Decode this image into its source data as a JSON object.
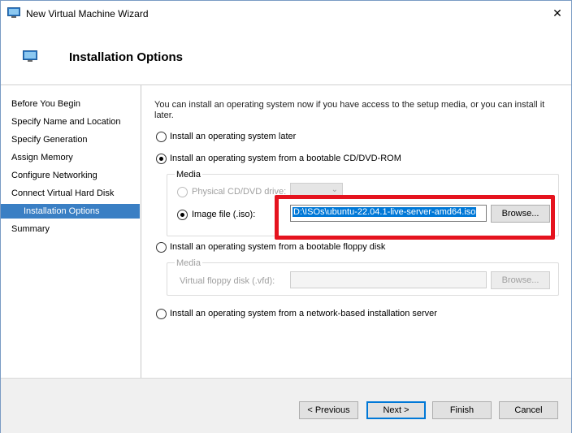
{
  "window": {
    "title": "New Virtual Machine Wizard",
    "close_glyph": "✕"
  },
  "header": {
    "title": "Installation Options"
  },
  "nav": {
    "items": [
      {
        "label": "Before You Begin"
      },
      {
        "label": "Specify Name and Location"
      },
      {
        "label": "Specify Generation"
      },
      {
        "label": "Assign Memory"
      },
      {
        "label": "Configure Networking"
      },
      {
        "label": "Connect Virtual Hard Disk"
      },
      {
        "label": "Installation Options"
      },
      {
        "label": "Summary"
      }
    ],
    "active_index": 6
  },
  "content": {
    "intro": "You can install an operating system now if you have access to the setup media, or you can install it later.",
    "options": {
      "later": {
        "label": "Install an operating system later",
        "checked": false
      },
      "cd_dvd": {
        "label": "Install an operating system from a bootable CD/DVD-ROM",
        "checked": true
      },
      "floppy": {
        "label": "Install an operating system from a bootable floppy disk",
        "checked": false
      },
      "network": {
        "label": "Install an operating system from a network-based installation server",
        "checked": false
      }
    },
    "cd_media": {
      "legend": "Media",
      "physical_drive": {
        "label": "Physical CD/DVD drive:",
        "checked": false,
        "enabled": false,
        "value": ""
      },
      "image_file": {
        "label": "Image file (.iso):",
        "checked": true,
        "value": "D:\\ISOs\\ubuntu-22.04.1-live-server-amd64.iso"
      },
      "browse_label": "Browse..."
    },
    "floppy_media": {
      "legend": "Media",
      "vfd_label": "Virtual floppy disk (.vfd):",
      "vfd_value": "",
      "browse_label": "Browse..."
    }
  },
  "footer": {
    "previous_label": "< Previous",
    "next_label": "Next >",
    "finish_label": "Finish",
    "cancel_label": "Cancel"
  },
  "colors": {
    "accent": "#3a7fc4",
    "selection": "#0078d7",
    "highlight_box": "#e5131e"
  }
}
